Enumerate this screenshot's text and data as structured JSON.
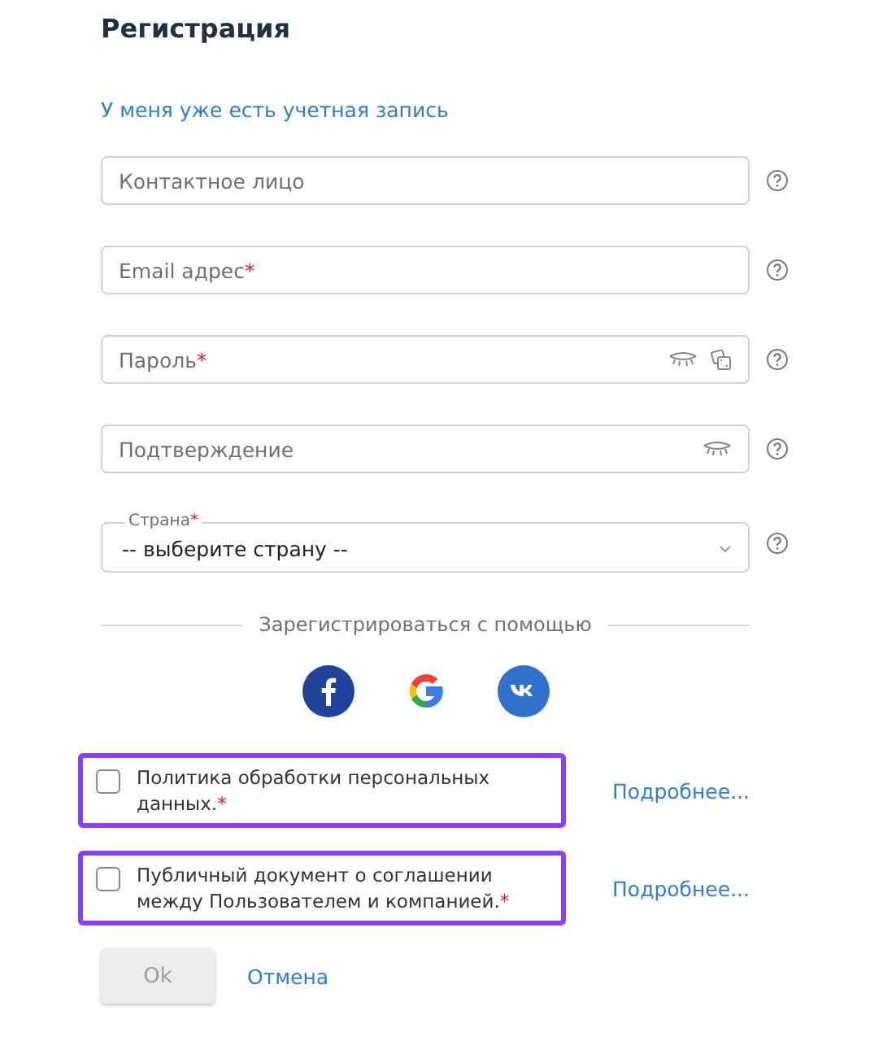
{
  "title": "Регистрация",
  "login_link": "У меня уже есть учетная запись",
  "fields": [
    {
      "kind": "text",
      "placeholder": "Контактное лицо"
    },
    {
      "kind": "text",
      "placeholder": "Email адрес",
      "required_mark": "*"
    },
    {
      "kind": "password",
      "placeholder": "Пароль",
      "required_mark": "*",
      "generator": true
    },
    {
      "kind": "password",
      "placeholder": "Подтверждение"
    },
    {
      "kind": "select",
      "label": "Страна",
      "required_mark": "*",
      "value": "-- выберите страну --"
    }
  ],
  "social": {
    "caption": "Зарегистрироваться с помощью",
    "networks": [
      {
        "kind": "facebook"
      },
      {
        "kind": "google"
      },
      {
        "kind": "vk"
      }
    ]
  },
  "agreements": [
    {
      "text": "Политика обработки персональных данных.",
      "required_mark": "*",
      "checked": false,
      "highlighted": true,
      "link": "Подробнее..."
    },
    {
      "text": "Публичный документ о соглашении между Пользователем и компанией.",
      "required_mark": "*",
      "checked": false,
      "highlighted": true,
      "link": "Подробнее..."
    }
  ],
  "buttons": {
    "ok": {
      "label": "Ok",
      "disabled": true
    },
    "cancel": "Отмена"
  }
}
